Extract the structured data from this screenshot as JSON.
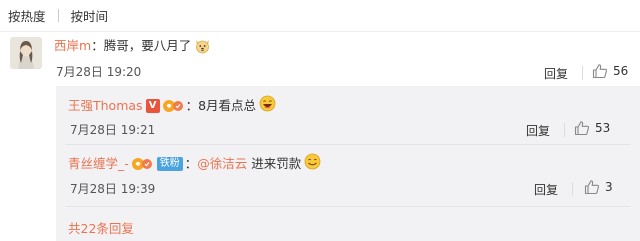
{
  "sort": {
    "by_hot": "按热度",
    "by_time": "按时间"
  },
  "comment": {
    "user": "西岸m",
    "text": "：腾哥，要八月了",
    "emoji": "dog-emoji",
    "time": "7月28日 19:20",
    "reply_label": "回复",
    "likes": "56"
  },
  "replies": [
    {
      "user": "王强Thomas",
      "badges": [
        "v-badge",
        "fan-badge"
      ],
      "text": "8月看点总",
      "emoji": "laugh-emoji",
      "time": "7月28日 19:21",
      "reply_label": "回复",
      "likes": "53"
    },
    {
      "user": "青丝缠学_-",
      "badges": [
        "fan-badge",
        "iron-fan-badge"
      ],
      "badge_label": "铁粉",
      "at_user": "@徐洁云",
      "text": "进来罚款",
      "emoji": "grin-emoji",
      "time": "7月28日 19:39",
      "reply_label": "回复",
      "likes": "3"
    }
  ],
  "total_replies": "共22条回复",
  "colors": {
    "username": "#eb7350",
    "reply_bg": "#f2f2f5",
    "v_badge": "#e8543c",
    "iron_badge": "#4aa3df"
  }
}
